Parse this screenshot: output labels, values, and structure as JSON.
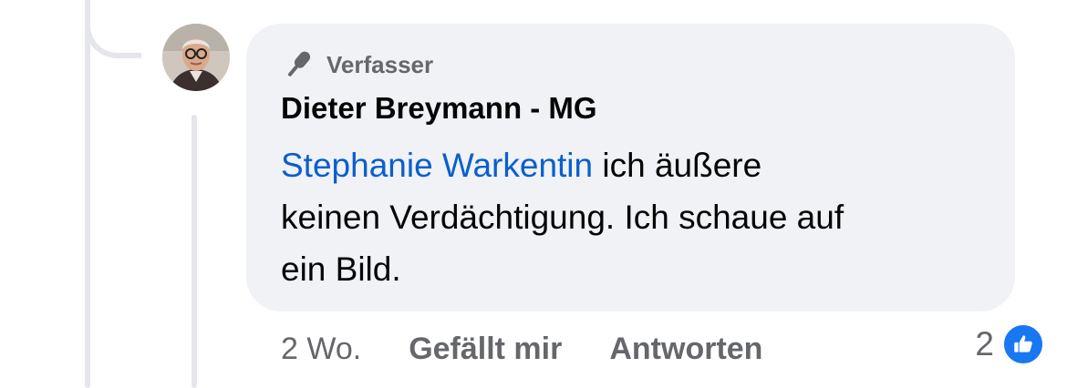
{
  "comment": {
    "badge_label": "Verfasser",
    "badge_icon": "microphone-icon",
    "author_name": "Dieter Breymann - MG",
    "mention": "Stephanie Warkentin",
    "text_line1_rest": " ich äußere",
    "text_line2": "keinen Verdächtigung. Ich schaue auf",
    "text_line3": "ein Bild.",
    "time": "2 Wo.",
    "like_label": "Gefällt mir",
    "reply_label": "Antworten",
    "reaction_count": "2",
    "reaction_icon": "thumbs-up-icon"
  },
  "colors": {
    "bubble": "#f0f2f5",
    "mention": "#0a5fcc",
    "like_accent": "#1877f2",
    "muted_text": "#65676b",
    "thread_line": "#e4e6eb"
  }
}
